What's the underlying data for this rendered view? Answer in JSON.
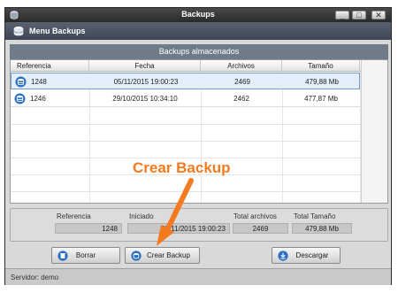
{
  "window": {
    "title": "Backups",
    "buttons": {
      "minimize": "_",
      "maximize": "□",
      "close": "✕"
    }
  },
  "menu": {
    "label": "Menu Backups"
  },
  "section": {
    "title": "Backups almacenados"
  },
  "table": {
    "columns": [
      "Referencia",
      "Fecha",
      "Archivos",
      "Tamaño"
    ],
    "rows": [
      {
        "referencia": "1248",
        "fecha": "05/11/2015 19:00:23",
        "archivos": "2469",
        "tamano": "479,88 Mb",
        "selected": true
      },
      {
        "referencia": "1246",
        "fecha": "29/10/2015 10:34:10",
        "archivos": "2462",
        "tamano": "477,87 Mb",
        "selected": false
      }
    ]
  },
  "details": {
    "referencia_label": "Referencia",
    "referencia_value": "1248",
    "iniciado_label": "Iniciado",
    "iniciado_value": "05/11/2015 19:00:23",
    "total_archivos_label": "Total archivos",
    "total_archivos_value": "2469",
    "total_tamano_label": "Total Tamaño",
    "total_tamano_value": "479,88 Mb"
  },
  "buttons": {
    "borrar": "Borrar",
    "crear_backup": "Crear Backup",
    "descargar": "Descargar"
  },
  "status": {
    "text": "Servidor: demo"
  },
  "annotation": {
    "text": "Crear Backup",
    "color": "#f47a20"
  },
  "colors": {
    "accent_blue": "#2a6fc4",
    "header_band": "#6f7b89",
    "menubar": "#4a5262",
    "selection": "#e4eefb"
  },
  "icons": {
    "app": "database-icon",
    "menu": "database-icon",
    "row": "database-icon",
    "borrar": "delete-icon",
    "crear": "backup-icon",
    "descargar": "download-icon"
  }
}
